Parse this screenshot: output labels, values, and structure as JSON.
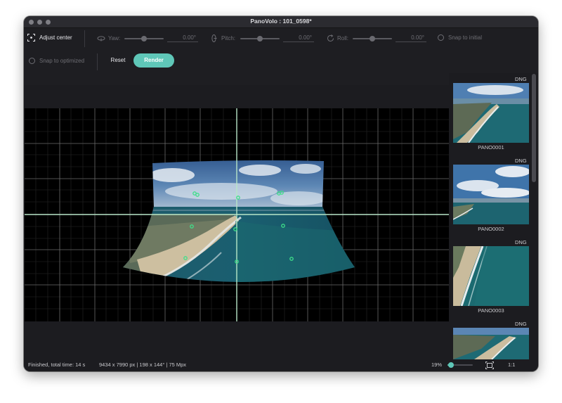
{
  "window": {
    "title": "PanoVolo : 101_0598*"
  },
  "toolbar": {
    "adjust_center_label": "Adjust center",
    "yaw_label": "Yaw:",
    "yaw_value": "0.00°",
    "pitch_label": "Pitch:",
    "pitch_value": "0.00°",
    "roll_label": "Roll:",
    "roll_value": "0.00°",
    "snap_initial_label": "Snap to initial",
    "snap_optimized_label": "Snap to optimized",
    "reset_label": "Reset",
    "render_label": "Render"
  },
  "thumbnails": [
    {
      "format": "DNG",
      "name": "PANO0001"
    },
    {
      "format": "DNG",
      "name": "PANO0002"
    },
    {
      "format": "DNG",
      "name": "PANO0003"
    },
    {
      "format": "DNG",
      "name": ""
    }
  ],
  "status": {
    "message": "Finished, total time: 14 s",
    "info": "9434 x 7990 px | 198 x 144° | 75 Mpx",
    "zoom": "19%",
    "one_to_one": "1:1",
    "zoom_level": 0.05
  },
  "colors": {
    "accent": "#5fc7b8",
    "control_point": "#3ee08a",
    "guide": "#b8e6c8"
  },
  "icons": {
    "adjust_center": "crosshair-frame-icon",
    "yaw": "yaw-rotate-icon",
    "pitch": "pitch-rotate-icon",
    "roll": "roll-rotate-icon",
    "fit": "fit-to-window-icon"
  }
}
